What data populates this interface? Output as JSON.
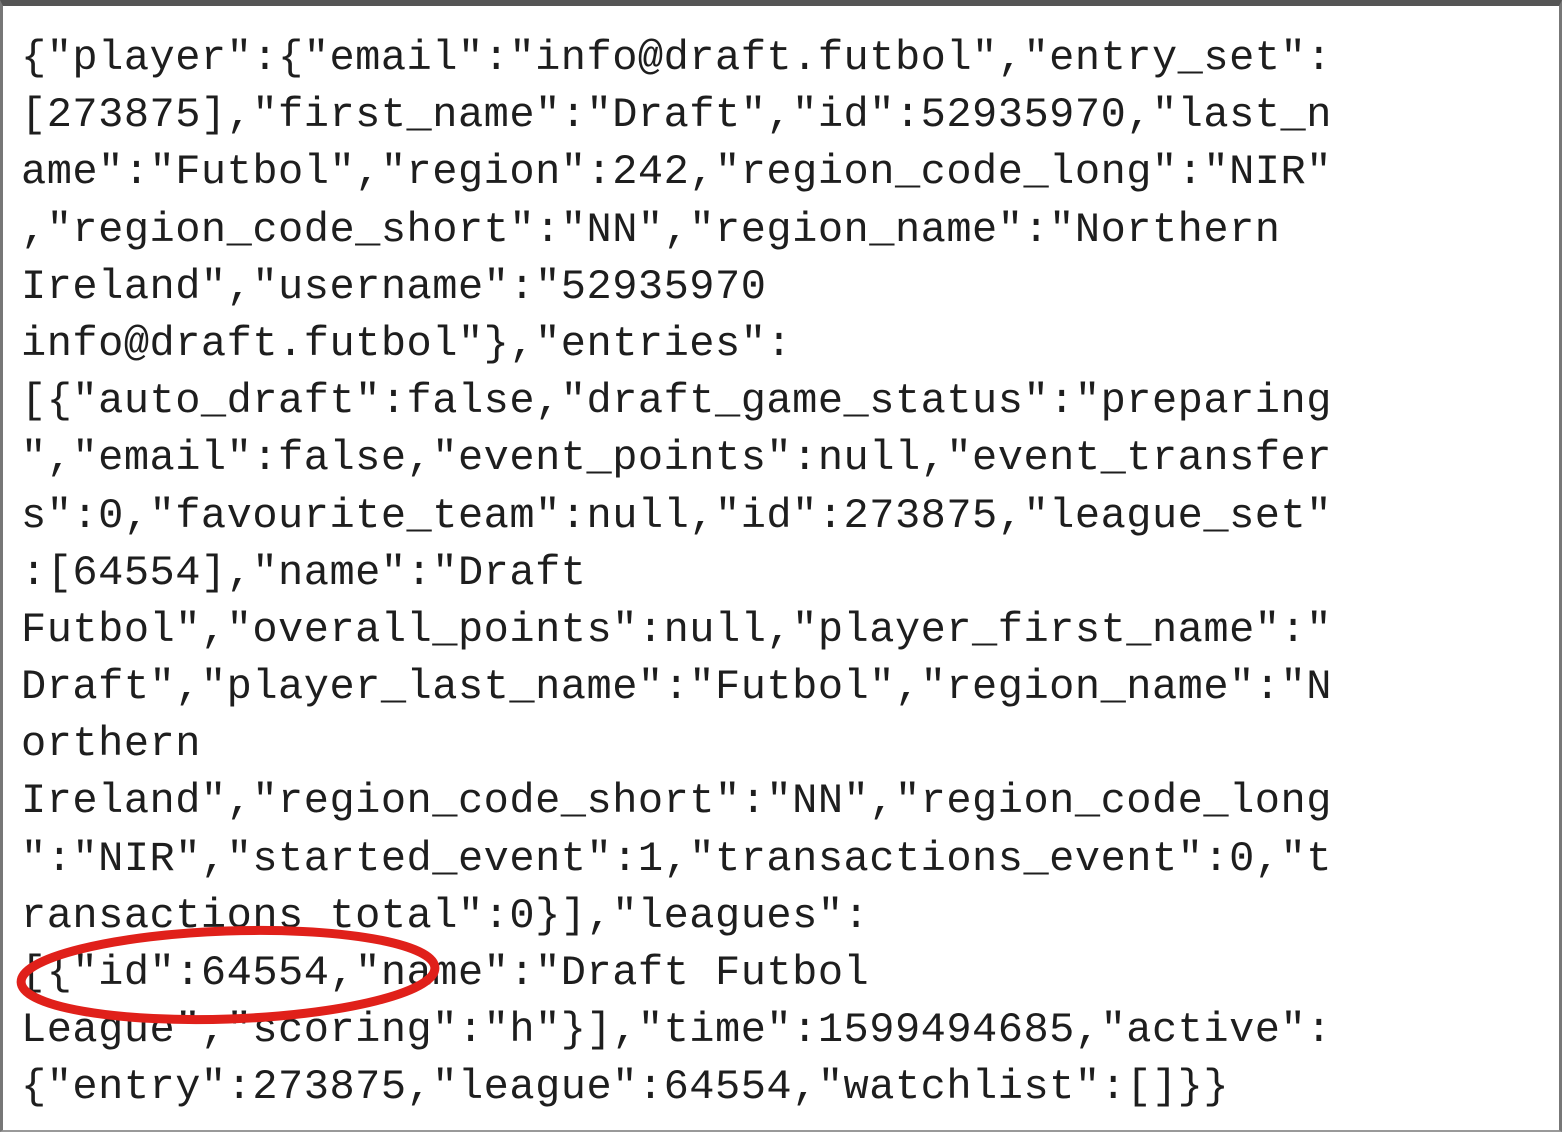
{
  "json_response": {
    "lines": [
      "{\"player\":{\"email\":\"info@draft.futbol\",\"entry_set\":",
      "[273875],\"first_name\":\"Draft\",\"id\":52935970,\"last_n",
      "ame\":\"Futbol\",\"region\":242,\"region_code_long\":\"NIR\"",
      ",\"region_code_short\":\"NN\",\"region_name\":\"Northern",
      "Ireland\",\"username\":\"52935970",
      "info@draft.futbol\"},\"entries\":",
      "[{\"auto_draft\":false,\"draft_game_status\":\"preparing",
      "\",\"email\":false,\"event_points\":null,\"event_transfer",
      "s\":0,\"favourite_team\":null,\"id\":273875,\"league_set\"",
      ":[64554],\"name\":\"Draft",
      "Futbol\",\"overall_points\":null,\"player_first_name\":\"",
      "Draft\",\"player_last_name\":\"Futbol\",\"region_name\":\"N",
      "orthern",
      "Ireland\",\"region_code_short\":\"NN\",\"region_code_long",
      "\":\"NIR\",\"started_event\":1,\"transactions_event\":0,\"t",
      "ransactions_total\":0}],\"leagues\":",
      "[{\"id\":64554,\"name\":\"Draft Futbol",
      "League\",\"scoring\":\"h\"}],\"time\":1599494685,\"active\":",
      "{\"entry\":273875,\"league\":64554,\"watchlist\":[]}}"
    ]
  },
  "annotation": {
    "color": "#e0201a",
    "shape": "ellipse",
    "highlighted_text": "\"id\":64554,"
  }
}
